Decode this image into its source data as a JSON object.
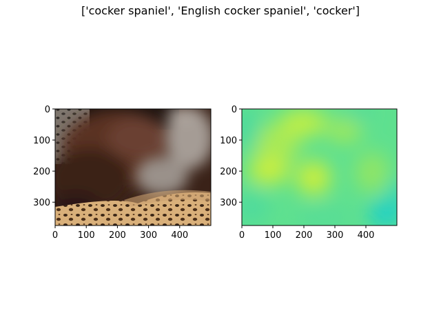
{
  "figure": {
    "title": "['cocker spaniel', 'English cocker spaniel', 'cocker']"
  },
  "panels": [
    {
      "id": "photo",
      "image_description": "photo of a dark brown dog and a grey puppy lying on a leopard-print blanket",
      "x_ticks": [
        "0",
        "100",
        "200",
        "300",
        "400"
      ],
      "y_ticks": [
        "0",
        "100",
        "200",
        "300"
      ]
    },
    {
      "id": "saliency",
      "image_description": "attribution heatmap in green/yellow tones",
      "x_ticks": [
        "0",
        "100",
        "200",
        "300",
        "400"
      ],
      "y_ticks": [
        "0",
        "100",
        "200",
        "300"
      ]
    }
  ],
  "axes": {
    "x_range": [
      0,
      500
    ],
    "y_range": [
      0,
      375
    ]
  },
  "colors": {
    "heat_base": "#5fe08f",
    "heat_yellow": "#c9ee3c",
    "heat_cyan": "#1ecfc8"
  }
}
